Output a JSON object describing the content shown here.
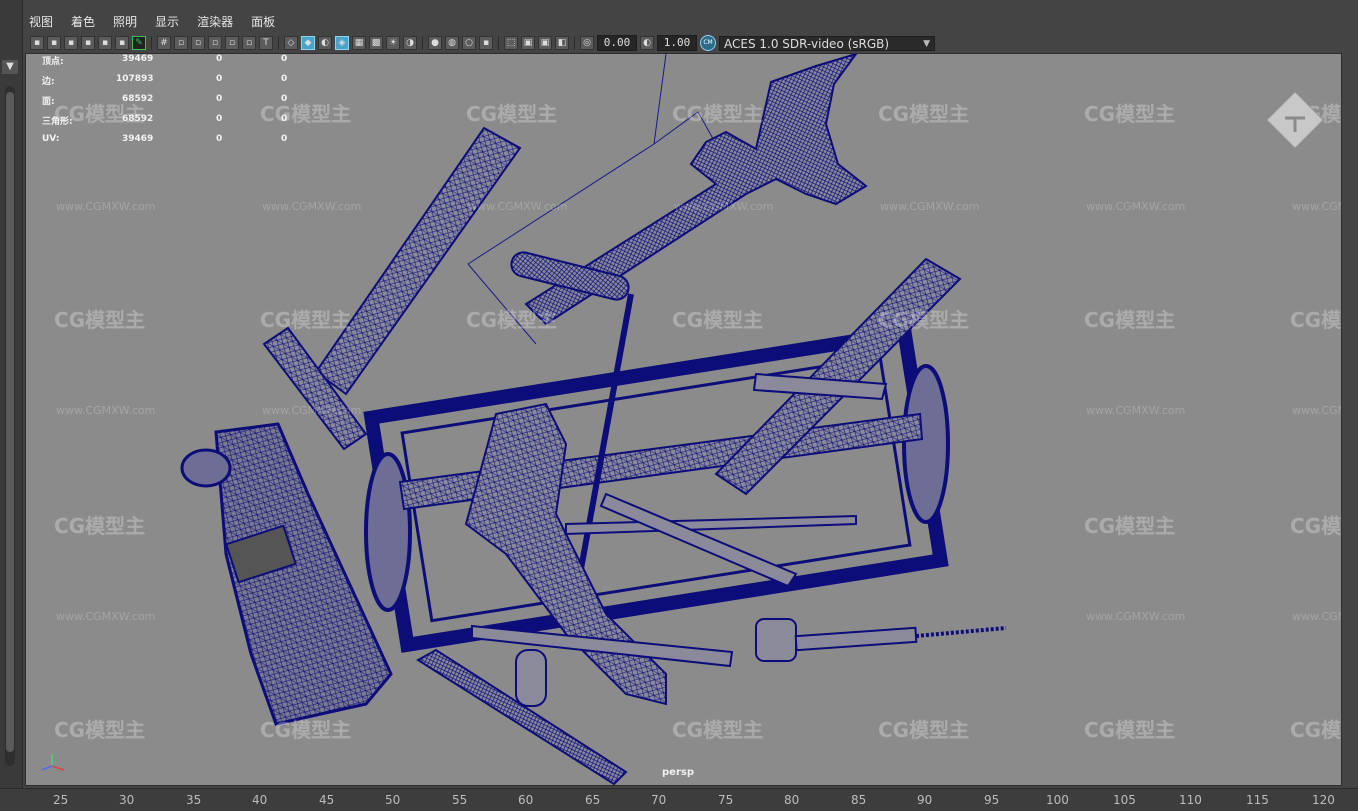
{
  "menu": [
    "视图",
    "着色",
    "照明",
    "显示",
    "渲染器",
    "面板"
  ],
  "toolbar": {
    "exposure": "0.00",
    "gamma": "1.00",
    "cm_badge": "CM",
    "colorspace": "ACES 1.0 SDR-video (sRGB)"
  },
  "hud": [
    {
      "label": "顶点:",
      "v1": "39469",
      "v2": "0",
      "v3": "0"
    },
    {
      "label": "边:",
      "v1": "107893",
      "v2": "0",
      "v3": "0"
    },
    {
      "label": "面:",
      "v1": "68592",
      "v2": "0",
      "v3": "0"
    },
    {
      "label": "三角形:",
      "v1": "68592",
      "v2": "0",
      "v3": "0"
    },
    {
      "label": "UV:",
      "v1": "39469",
      "v2": "0",
      "v3": "0"
    }
  ],
  "watermark": {
    "logo": "CG模型主",
    "url": "www.CGMXW.com"
  },
  "camera_label": "persp",
  "ruler": [
    "25",
    "30",
    "35",
    "40",
    "45",
    "50",
    "55",
    "60",
    "65",
    "70",
    "75",
    "80",
    "85",
    "90",
    "95",
    "100",
    "105",
    "110",
    "115",
    "120"
  ],
  "colors": {
    "wire": "#0d0d7a",
    "viewport_bg": "#8b8b8b",
    "accent": "#4aa3c8"
  }
}
